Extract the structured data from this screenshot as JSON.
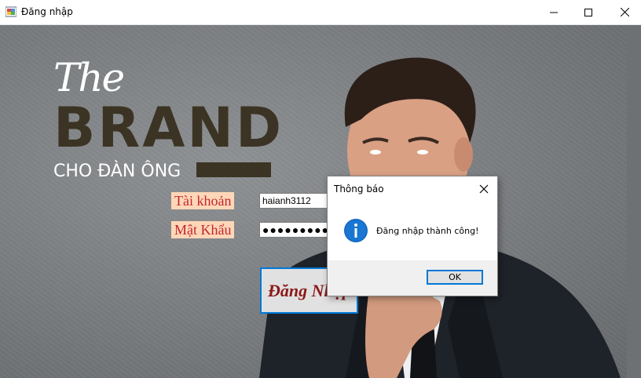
{
  "window": {
    "title": "Đăng nhập"
  },
  "brand": {
    "the": "The",
    "word": "BRAND",
    "tagline": "CHO ĐÀN ÔNG"
  },
  "form": {
    "username_label": "Tài khoản",
    "username_value": "haianh3112",
    "password_label": "Mật Khẩu",
    "password_mask": "●●●●●●●●●●",
    "login_button": "Đăng Nhập"
  },
  "dialog": {
    "title": "Thông báo",
    "message": "Đăng nhập thành công!",
    "ok_label": "OK",
    "icon": "info-icon"
  },
  "colors": {
    "accent": "#0078d7",
    "label_bg": "#ffd7b8",
    "label_text": "#c1272d",
    "brand_dark": "#3b3424"
  }
}
